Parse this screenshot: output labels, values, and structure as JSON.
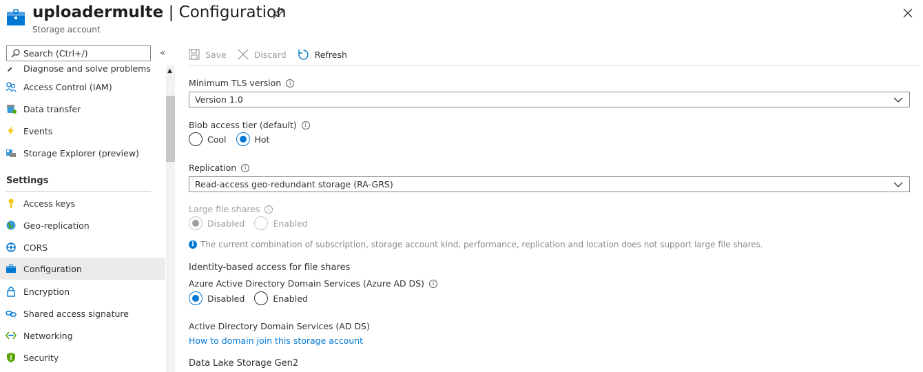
{
  "header": {
    "resource_name": "uploadermulte",
    "separator": " | ",
    "page_name": "Configuration",
    "subtitle": "Storage account"
  },
  "sidebar": {
    "search_placeholder": "Search (Ctrl+/)",
    "collapse_glyph": "«",
    "scroll_up_glyph": "▲",
    "items_top": [
      {
        "label": "Diagnose and solve problems",
        "icon": "wrench-icon"
      },
      {
        "label": "Access Control (IAM)",
        "icon": "people-icon"
      },
      {
        "label": "Data transfer",
        "icon": "data-transfer-icon"
      },
      {
        "label": "Events",
        "icon": "lightning-icon"
      },
      {
        "label": "Storage Explorer (preview)",
        "icon": "storage-explorer-icon"
      }
    ],
    "settings_header": "Settings",
    "items_settings": [
      {
        "label": "Access keys",
        "icon": "key-icon"
      },
      {
        "label": "Geo-replication",
        "icon": "globe-icon"
      },
      {
        "label": "CORS",
        "icon": "cors-icon"
      },
      {
        "label": "Configuration",
        "icon": "configuration-icon",
        "active": true
      },
      {
        "label": "Encryption",
        "icon": "lock-icon"
      },
      {
        "label": "Shared access signature",
        "icon": "link-icon"
      },
      {
        "label": "Networking",
        "icon": "networking-icon"
      },
      {
        "label": "Security",
        "icon": "shield-icon"
      }
    ]
  },
  "toolbar": {
    "save_label": "Save",
    "discard_label": "Discard",
    "refresh_label": "Refresh"
  },
  "form": {
    "tls": {
      "label": "Minimum TLS version",
      "value": "Version 1.0"
    },
    "blob_tier": {
      "label": "Blob access tier (default)",
      "options": [
        "Cool",
        "Hot"
      ],
      "selected": "Hot"
    },
    "replication": {
      "label": "Replication",
      "value": "Read-access geo-redundant storage (RA-GRS)"
    },
    "large_file_shares": {
      "label": "Large file shares",
      "options": [
        "Disabled",
        "Enabled"
      ],
      "selected": "Disabled",
      "disabled": true
    },
    "notice": "The current combination of subscription, storage account kind, performance, replication and location does not support large file shares.",
    "identity_header": "Identity-based access for file shares",
    "aadds": {
      "label": "Azure Active Directory Domain Services (Azure AD DS)",
      "options": [
        "Disabled",
        "Enabled"
      ],
      "selected": "Disabled"
    },
    "adds_header": "Active Directory Domain Services (AD DS)",
    "adds_link": "How to domain join this storage account",
    "datalake_header": "Data Lake Storage Gen2"
  },
  "colors": {
    "accent": "#0078d4",
    "active_bg": "#edebe9",
    "disabled_text": "#a19f9d"
  }
}
